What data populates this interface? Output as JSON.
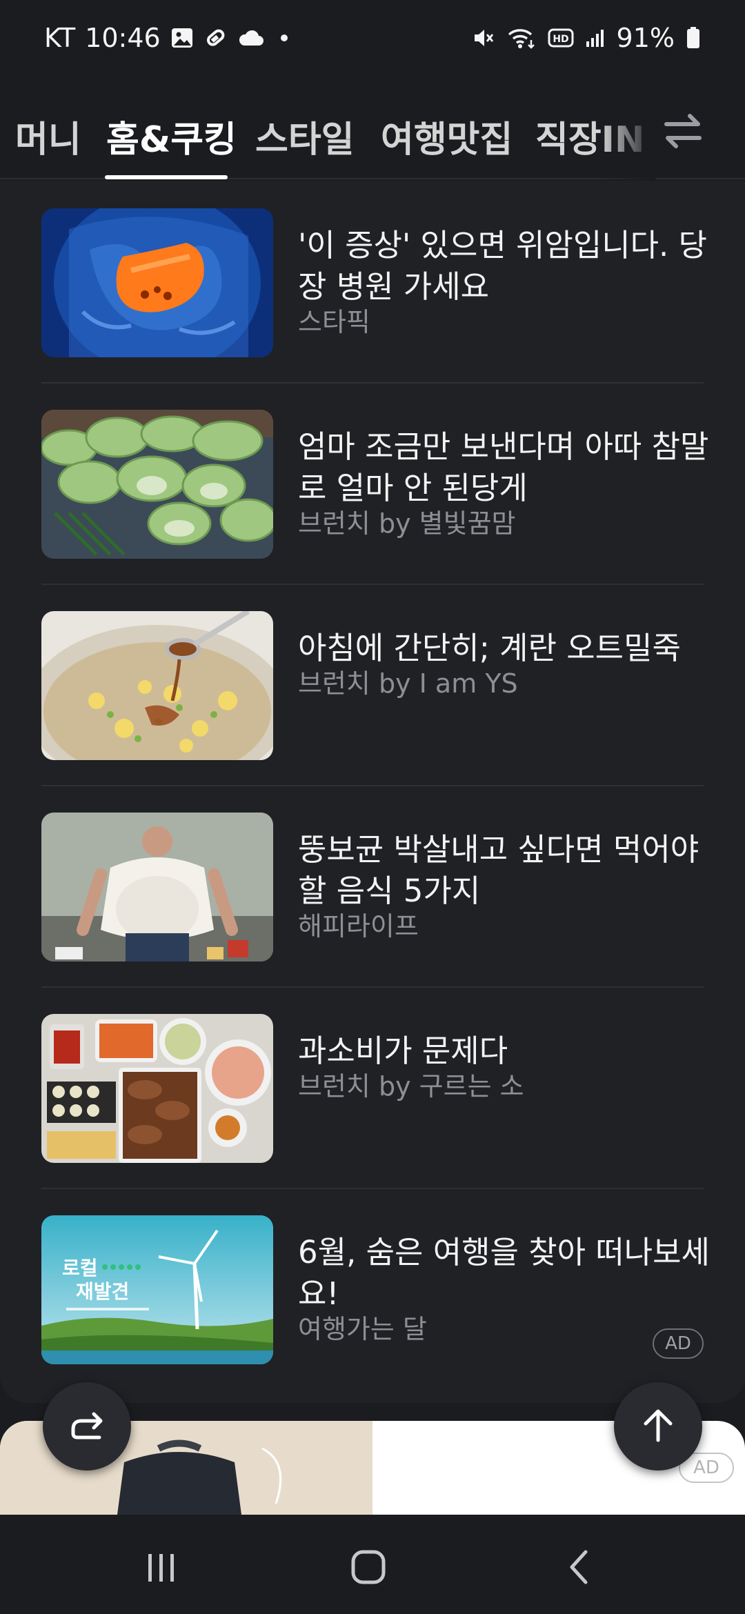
{
  "status_bar": {
    "carrier": "KT",
    "time": "10:46",
    "battery": "91%"
  },
  "tabs": [
    {
      "label": "머니"
    },
    {
      "label": "홈&쿠킹"
    },
    {
      "label": "스타일"
    },
    {
      "label": "여행맛집"
    },
    {
      "label": "직장IN"
    }
  ],
  "active_tab": "홈&쿠킹",
  "articles": [
    {
      "title": "'이 증상' 있으면 위암입니다. 당장 병원 가세요",
      "source": "스타픽",
      "thumb": "stomach"
    },
    {
      "title": "엄마 조금만 보낸다며 아따 참말로 얼마 안 된당게",
      "source": "브런치 by 별빛꿈맘",
      "thumb": "cabbage"
    },
    {
      "title": "아침에 간단히; 계란 오트밀죽",
      "source": "브런치 by I am YS",
      "thumb": "oatmeal"
    },
    {
      "title": "뚱보균 박살내고 싶다면 먹어야 할 음식 5가지",
      "source": "해피라이프",
      "thumb": "man"
    },
    {
      "title": "과소비가 문제다",
      "source": "브런치 by 구르는 소",
      "thumb": "food"
    },
    {
      "title": "6월, 숨은 여행을 찾아 떠나보세요!",
      "source": "여행가는 달",
      "thumb": "windmill",
      "badge": "AD"
    }
  ],
  "thumb_text": {
    "windmill_line1": "로컬",
    "windmill_line2": "재발견"
  },
  "bottom_ad": {
    "badge": "AD"
  },
  "colors": {
    "background": "#1b1c20",
    "card": "#202125",
    "muted_text": "#8e8f95"
  },
  "icons": [
    "image-icon",
    "link-icon",
    "cloud-icon",
    "mute-icon",
    "wifi-icon",
    "hd-icon",
    "signal-icon",
    "battery-icon",
    "swap-icon",
    "share-icon",
    "arrow-up-icon",
    "recent-apps-icon",
    "home-icon",
    "back-icon"
  ]
}
